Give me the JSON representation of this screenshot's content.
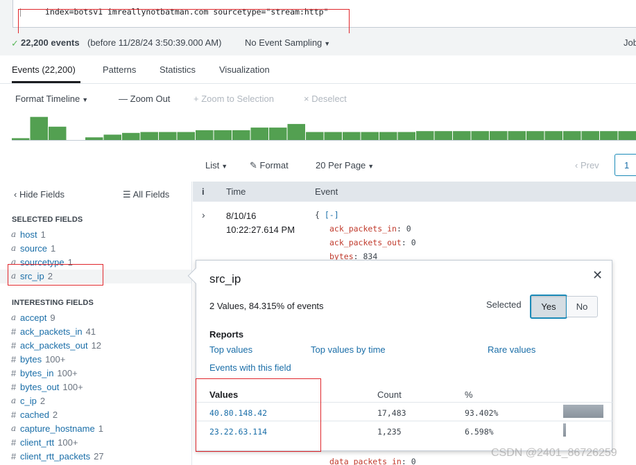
{
  "search": {
    "query": "index=botsv1 imreallynotbatman.com sourcetype=\"stream:http\""
  },
  "status": {
    "events_count": "22,200 events",
    "before_text": "(before 11/28/24 3:50:39.000 AM)",
    "sampling": "No Event Sampling",
    "job": "Job"
  },
  "tabs": [
    {
      "label": "Events (22,200)",
      "active": true
    },
    {
      "label": "Patterns"
    },
    {
      "label": "Statistics"
    },
    {
      "label": "Visualization"
    }
  ],
  "timeline_toolbar": {
    "format_timeline": "Format Timeline",
    "zoom_out": "Zoom Out",
    "zoom_to_selection": "+ Zoom to Selection",
    "deselect": "× Deselect"
  },
  "chart_data": {
    "type": "bar",
    "title": "",
    "values": [
      2,
      26,
      15,
      0,
      3,
      6,
      8,
      9,
      9,
      9,
      11,
      11,
      11,
      14,
      14,
      18,
      9,
      9,
      9,
      9,
      9,
      9,
      10,
      10,
      10,
      10,
      10,
      10,
      10,
      10,
      10,
      10,
      10,
      10
    ],
    "ylim": [
      0,
      32
    ],
    "color": "#53a051"
  },
  "results_toolbar": {
    "list": "List",
    "format": "Format",
    "per_page": "20 Per Page",
    "prev": "‹ Prev",
    "page": "1"
  },
  "sidebar": {
    "hide_fields": "Hide Fields",
    "all_fields": "All Fields",
    "selected_title": "SELECTED FIELDS",
    "selected_fields": [
      {
        "type": "a",
        "name": "host",
        "count": "1"
      },
      {
        "type": "a",
        "name": "source",
        "count": "1"
      },
      {
        "type": "a",
        "name": "sourcetype",
        "count": "1"
      },
      {
        "type": "a",
        "name": "src_ip",
        "count": "2"
      }
    ],
    "interesting_title": "INTERESTING FIELDS",
    "interesting_fields": [
      {
        "type": "a",
        "name": "accept",
        "count": "9"
      },
      {
        "type": "#",
        "name": "ack_packets_in",
        "count": "41"
      },
      {
        "type": "#",
        "name": "ack_packets_out",
        "count": "12"
      },
      {
        "type": "#",
        "name": "bytes",
        "count": "100+"
      },
      {
        "type": "#",
        "name": "bytes_in",
        "count": "100+"
      },
      {
        "type": "#",
        "name": "bytes_out",
        "count": "100+"
      },
      {
        "type": "a",
        "name": "c_ip",
        "count": "2"
      },
      {
        "type": "#",
        "name": "cached",
        "count": "2"
      },
      {
        "type": "a",
        "name": "capture_hostname",
        "count": "1"
      },
      {
        "type": "#",
        "name": "client_rtt",
        "count": "100+"
      },
      {
        "type": "#",
        "name": "client_rtt_packets",
        "count": "27"
      }
    ]
  },
  "events": {
    "col_info": "i",
    "col_time": "Time",
    "col_event": "Event",
    "date": "8/10/16",
    "time": "10:22:27.614 PM",
    "json_open": "{",
    "json_collapse": "[-]",
    "fields": [
      {
        "key": "ack_packets_in",
        "value": "0"
      },
      {
        "key": "ack_packets_out",
        "value": "0"
      },
      {
        "key": "bytes",
        "value": "834"
      }
    ],
    "bottom_key": "data_packets_in",
    "bottom_value": "0"
  },
  "popup": {
    "title": "src_ip",
    "summary": "2 Values, 84.315% of events",
    "selected_label": "Selected",
    "yes": "Yes",
    "no": "No",
    "reports_title": "Reports",
    "top_values": "Top values",
    "top_values_by_time": "Top values by time",
    "rare_values": "Rare values",
    "events_with_field": "Events with this field",
    "col_values": "Values",
    "col_count": "Count",
    "col_pct": "%",
    "rows": [
      {
        "value": "40.80.148.42",
        "count": "17,483",
        "pct": "93.402%",
        "fraction": 0.93402
      },
      {
        "value": "23.22.63.114",
        "count": "1,235",
        "pct": "6.598%",
        "fraction": 0.06598
      }
    ]
  },
  "watermark": "CSDN @2401_86726259"
}
